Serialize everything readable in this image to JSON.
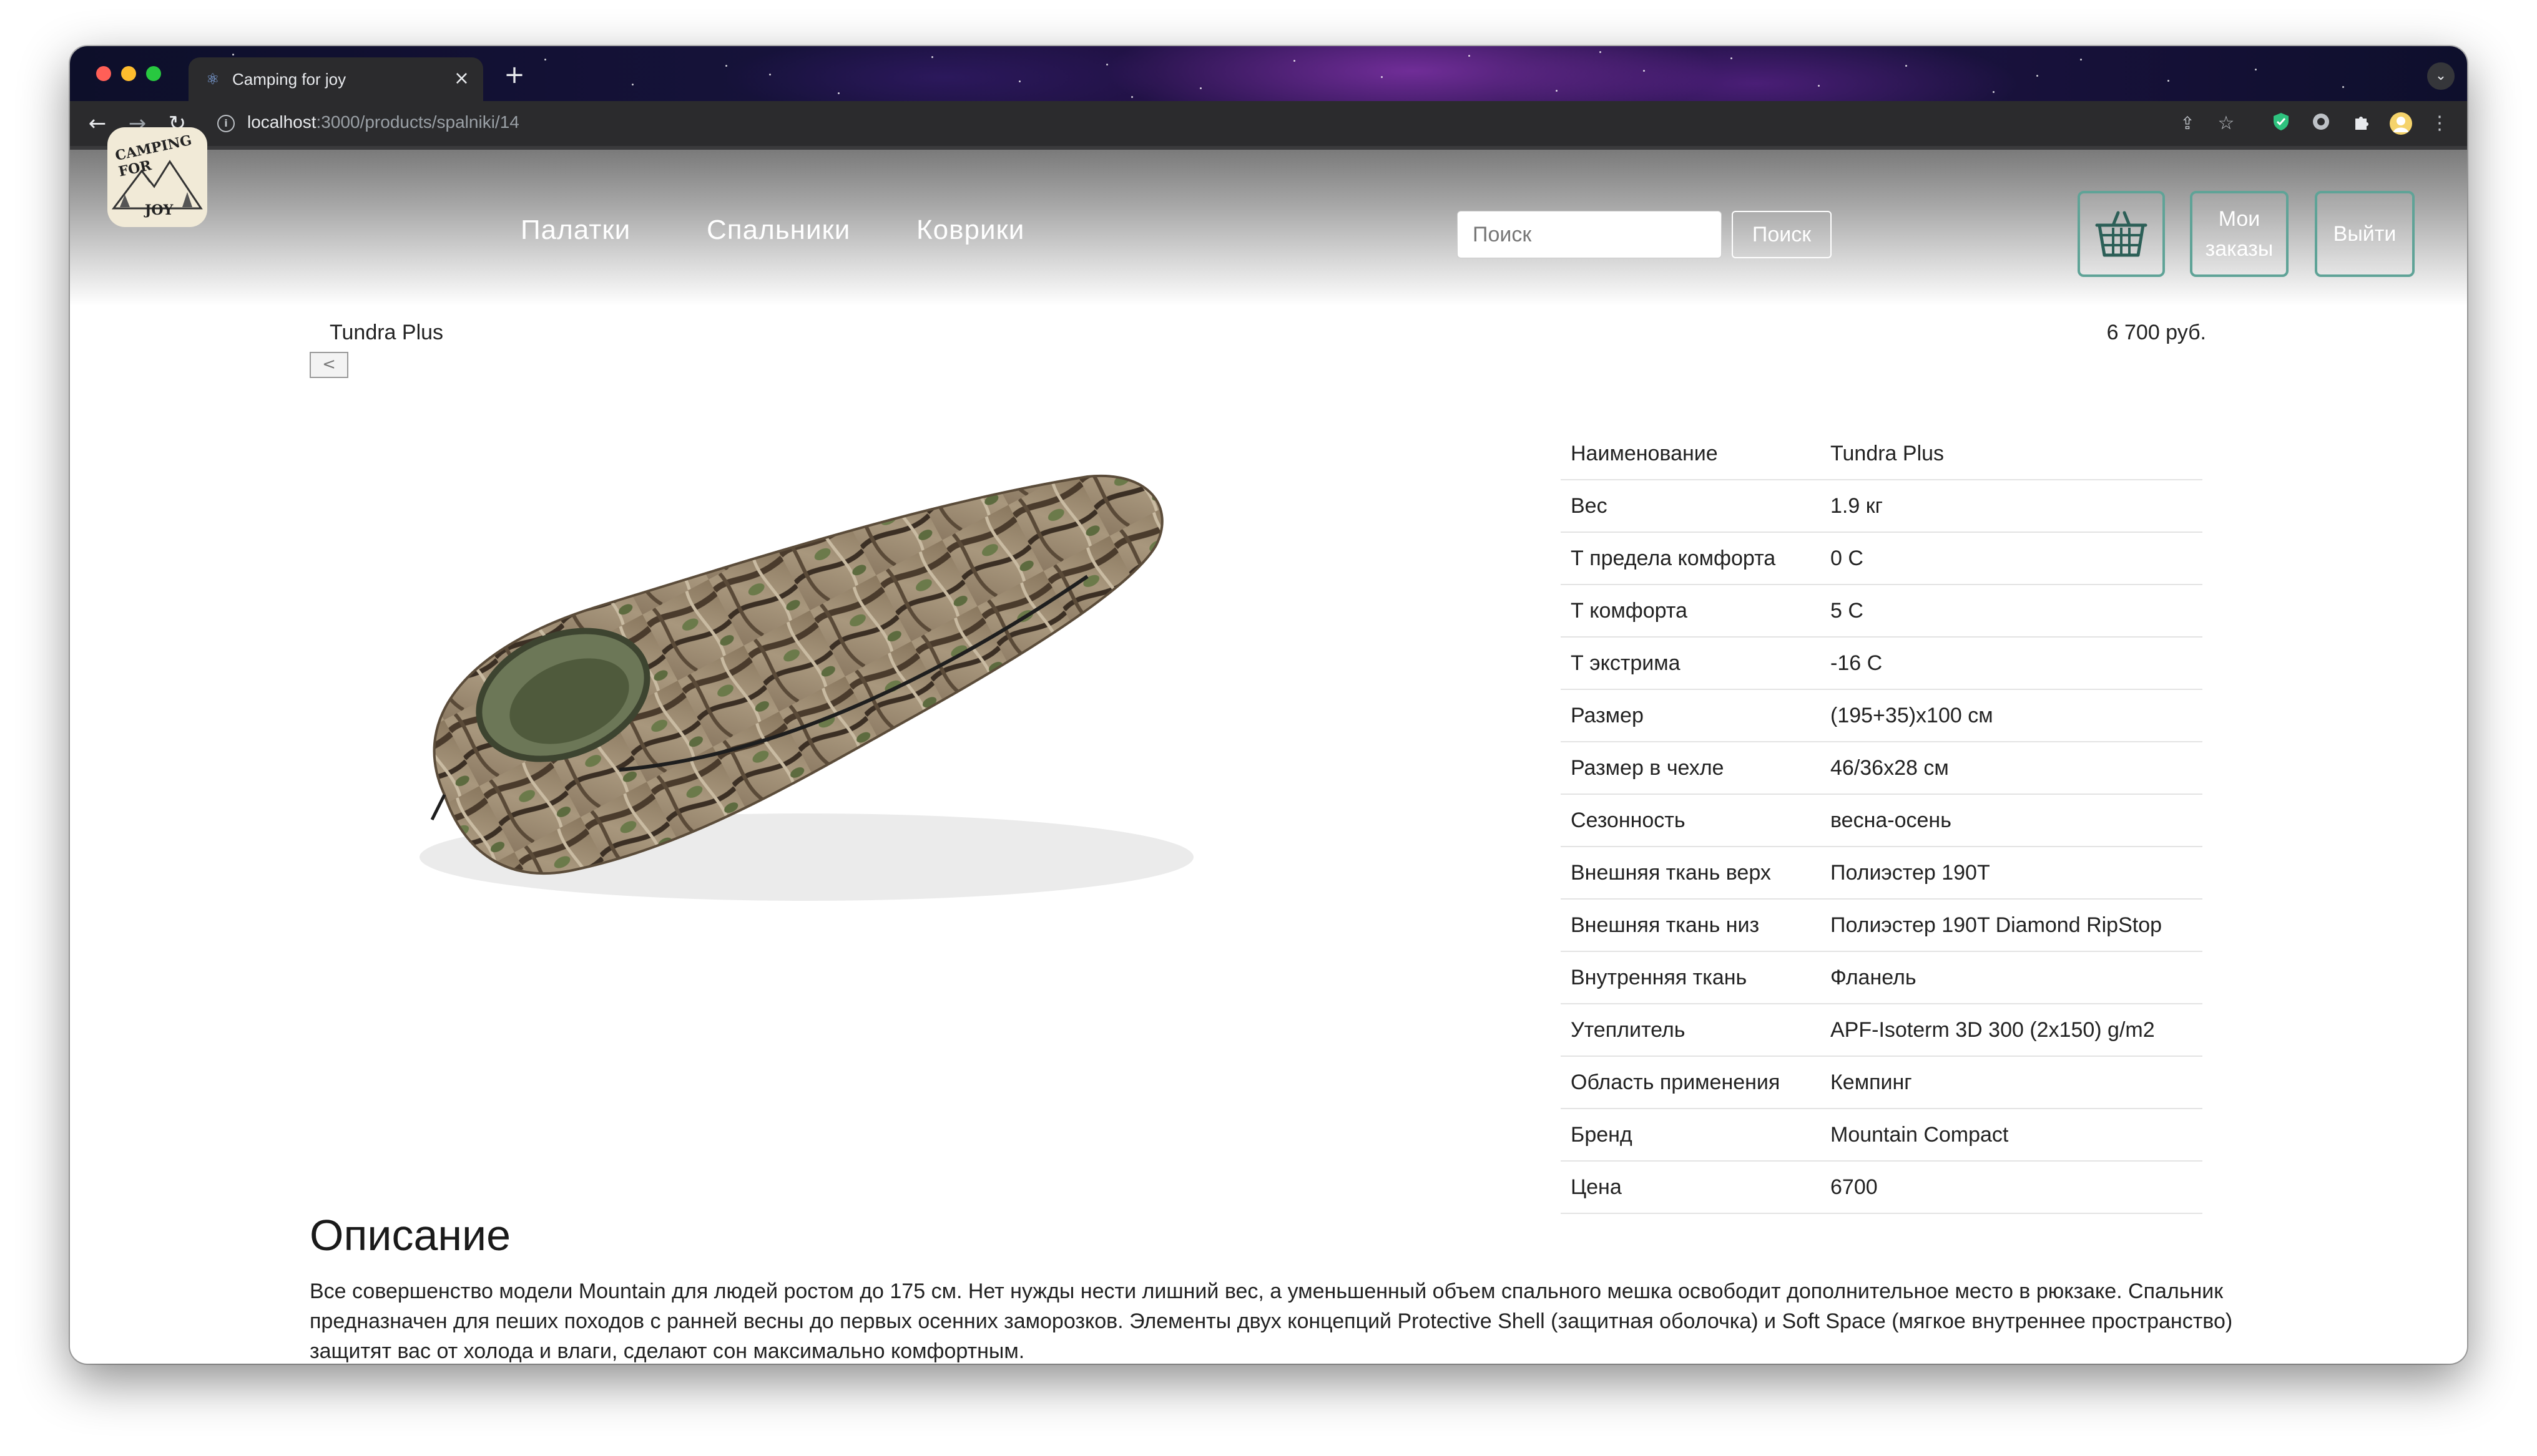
{
  "browser": {
    "tab_title": "Camping for joy",
    "url_host": "localhost",
    "url_path": ":3000/products/spalniki/14",
    "colors": {
      "frame": "#2b2b2d",
      "tab_text": "#e8eaed"
    },
    "icons": [
      "react-icon",
      "close-icon",
      "plus-icon",
      "chevron-down-icon",
      "back-arrow-icon",
      "forward-arrow-icon",
      "reload-icon",
      "info-icon",
      "share-icon",
      "star-icon",
      "shield-icon",
      "extension-icon",
      "puzzle-icon",
      "avatar-icon",
      "kebab-menu-icon"
    ]
  },
  "header": {
    "logo_text_top": "CAMPING FOR",
    "logo_text_bottom": "JOY",
    "nav": [
      "Палатки",
      "Спальники",
      "Коврики"
    ],
    "search_placeholder": "Поиск",
    "search_button": "Поиск",
    "cart_icon": "basket-icon",
    "orders_line1": "Мои",
    "orders_line2": "заказы",
    "logout": "Выйти",
    "accent": "#5fa397"
  },
  "product": {
    "title": "Tundra Plus",
    "price": "6 700 руб.",
    "back_label": "<",
    "specs": [
      {
        "key": "Наименование",
        "value": "Tundra Plus"
      },
      {
        "key": "Вес",
        "value": "1.9 кг"
      },
      {
        "key": "Т предела комфорта",
        "value": "0 С"
      },
      {
        "key": "Т комфорта",
        "value": "5 С"
      },
      {
        "key": "Т экстрима",
        "value": "-16 С"
      },
      {
        "key": "Размер",
        "value": "(195+35)x100 см"
      },
      {
        "key": "Размер в чехле",
        "value": "46/36x28 см"
      },
      {
        "key": "Сезонность",
        "value": "весна-осень"
      },
      {
        "key": "Внешняя ткань верх",
        "value": "Полиэстер 190T"
      },
      {
        "key": "Внешняя ткань низ",
        "value": "Полиэстер 190T Diamond RipStop"
      },
      {
        "key": "Внутренняя ткань",
        "value": "Фланель"
      },
      {
        "key": "Утеплитель",
        "value": "APF-Isoterm 3D 300 (2x150) g/m2"
      },
      {
        "key": "Область применения",
        "value": "Кемпинг"
      },
      {
        "key": "Бренд",
        "value": "Mountain Compact"
      },
      {
        "key": "Цена",
        "value": "6700"
      }
    ],
    "description_title": "Описание",
    "description": "Все совершенство модели Mountain для людей ростом до 175 см. Нет нужды нести лишний вес, а уменьшенный объем спального мешка освободит дополнительное место в рюкзаке. Спальник предназначен для пеших походов с ранней весны до первых осенних заморозков. Элементы двух концепций Protective Shell (защитная оболочка) и Soft Space (мягкое внутреннее пространство) защитят вас от холода и влаги, сделают сон максимально комфортным."
  }
}
